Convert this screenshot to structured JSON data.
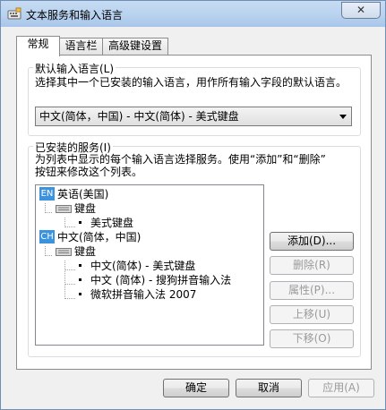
{
  "window": {
    "title": "文本服务和输入语言",
    "close_label": "✕"
  },
  "tabs": [
    {
      "label": "常规",
      "active": true
    },
    {
      "label": "语言栏",
      "active": false
    },
    {
      "label": "高级键设置",
      "active": false
    }
  ],
  "default_lang": {
    "group_title": "默认输入语言(L)",
    "description": "选择其中一个已安装的输入语言，用作所有输入字段的默认语言。",
    "selected": "中文(简体，中国) - 中文(简体) - 美式键盘"
  },
  "installed": {
    "group_title": "已安装的服务(I)",
    "description_line1": "为列表中显示的每个输入语言选择服务。使用“添加”和“删除”",
    "description_line2": "按钮来修改这个列表。",
    "tree": {
      "lang1": {
        "badge": "EN",
        "label": "英语(美国)"
      },
      "lang1_keyboard": "键盘",
      "lang1_item1": "美式键盘",
      "lang2": {
        "badge": "CH",
        "label": "中文(简体，中国)"
      },
      "lang2_keyboard": "键盘",
      "lang2_item1": "中文(简体) - 美式键盘",
      "lang2_item2": "中文 (简体) - 搜狗拼音输入法",
      "lang2_item3": "微软拼音输入法 2007"
    },
    "buttons": {
      "add": "添加(D)...",
      "remove": "删除(R)",
      "properties": "属性(P)...",
      "move_up": "上移(U)",
      "move_down": "下移(O)"
    }
  },
  "footer": {
    "ok": "确定",
    "cancel": "取消",
    "apply": "应用(A)"
  },
  "colors": {
    "badge": "#3c93dd",
    "titlebar": "#b7d1ee"
  }
}
